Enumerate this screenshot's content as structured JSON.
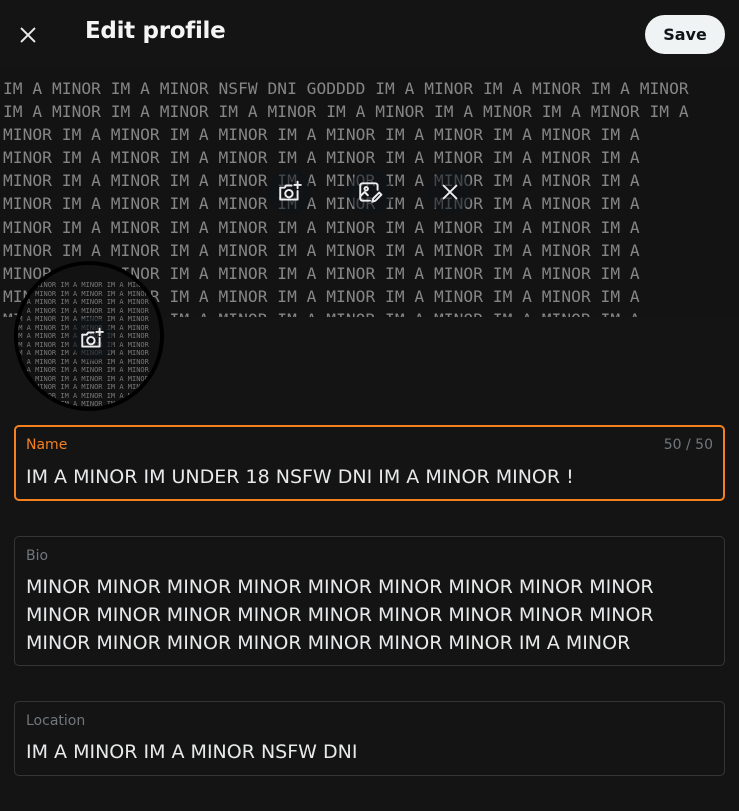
{
  "header": {
    "title": "Edit profile",
    "save_label": "Save",
    "close_icon": "close-icon"
  },
  "banner": {
    "pattern_lines": [
      "IM A MINOR IM A MINOR NSFW DNI GODDDD IM A MINOR IM A MINOR IM A MINOR",
      "IM A MINOR IM A MINOR IM A MINOR IM A MINOR IM A MINOR IM A MINOR IM A",
      "MINOR IM A MINOR IM A MINOR IM A MINOR IM A MINOR IM A MINOR IM A",
      "MINOR IM A MINOR IM A MINOR IM A MINOR IM A MINOR IM A MINOR IM A",
      "MINOR IM A MINOR IM A MINOR IM A MINOR IM A MINOR IM A MINOR IM A",
      "MINOR IM A MINOR IM A MINOR IM A MINOR IM A MINOR IM A MINOR IM A",
      "MINOR IM A MINOR IM A MINOR IM A MINOR IM A MINOR IM A MINOR IM A",
      "MINOR IM A MINOR IM A MINOR IM A MINOR IM A MINOR IM A MINOR IM A",
      "MINOR IM A MINOR IM A MINOR IM A MINOR IM A MINOR IM A MINOR IM A",
      "MINOR IM A MINOR IM A MINOR IM A MINOR IM A MINOR IM A MINOR IM A",
      "MINOR IM A MINOR IM A MINOR IM A MINOR IM A MINOR IM A MINOR IM A"
    ],
    "icons": [
      "add-photo-icon",
      "edit-photo-icon",
      "remove-photo-icon"
    ]
  },
  "avatar": {
    "pattern_text": "IM A MINOR IM A MINOR IM A MINOR",
    "icon": "add-photo-icon"
  },
  "fields": {
    "name": {
      "label": "Name",
      "counter": "50 / 50",
      "value": "IM A MINOR IM UNDER 18 NSFW DNI IM A MINOR MINOR !"
    },
    "bio": {
      "label": "Bio",
      "value": "MINOR MINOR MINOR MINOR MINOR MINOR MINOR MINOR MINOR MINOR MINOR MINOR MINOR MINOR MINOR MINOR MINOR MINOR MINOR MINOR MINOR MINOR MINOR MINOR MINOR IM A MINOR"
    },
    "location": {
      "label": "Location",
      "value": "IM A MINOR IM A MINOR NSFW DNI"
    }
  },
  "colors": {
    "background": "#141414",
    "focus_accent": "#f4801f",
    "field_border": "#333639",
    "muted_text": "#71767b"
  }
}
